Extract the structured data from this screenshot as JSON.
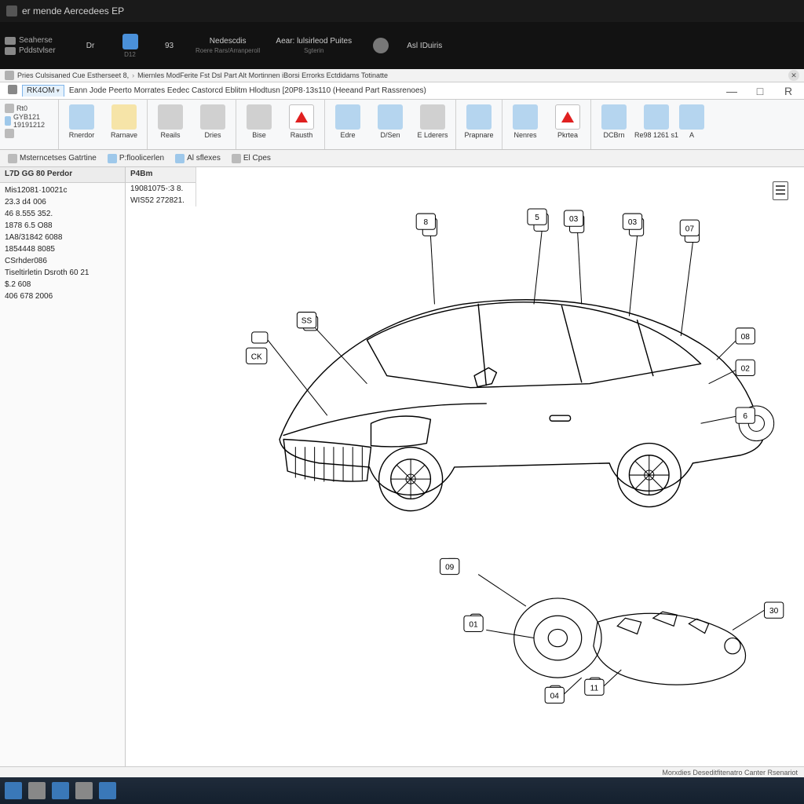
{
  "titlebar": {
    "text": "er mende Aercedees EP"
  },
  "darkband": {
    "sidecol": [
      {
        "icon": "doc-icon",
        "label": "Seaherse"
      },
      {
        "icon": "db-icon",
        "label": "Pddstvlser"
      }
    ],
    "buttons": [
      {
        "name": "dark-btn-1",
        "label1": "Dr",
        "label2": "",
        "variant": "gray"
      },
      {
        "name": "dark-btn-2",
        "label1": "",
        "label2": "D12",
        "variant": "blue"
      },
      {
        "name": "dark-btn-3",
        "label1": "93",
        "label2": "",
        "variant": "blue"
      },
      {
        "name": "dark-btn-4",
        "label1": "Nedescdis",
        "label2": "Roere Rars/Arranperoll",
        "variant": "gray"
      },
      {
        "name": "dark-btn-5",
        "label1": "Aear: lulsirleod Puites",
        "label2": "Sgterin",
        "variant": "gray"
      },
      {
        "name": "dark-btn-6",
        "label1": "",
        "label2": "",
        "variant": "gear"
      },
      {
        "name": "dark-btn-7",
        "label1": "Asl IDuiris",
        "label2": "",
        "variant": "gray"
      }
    ]
  },
  "crumbs": [
    "Pries Culsisaned Cue Estherseet 8,",
    "Miernles ModFerite Fst Dsl Part Alt Mortinnen iBorsi Errorks Ectdidams Totinatte"
  ],
  "menubar": {
    "items": [
      {
        "name": "menu-icon-1",
        "label": "",
        "icon": true
      },
      {
        "name": "menu-item-0",
        "label": "RK4OM",
        "dropdown": true,
        "selected": true
      },
      {
        "name": "menu-item-1",
        "label": "Eann Jode Peerto Morrates Eedec Castorcd Eblitm Hlodtusn [20P8·13s110  (Heeand   Part Rassrenoes)"
      }
    ]
  },
  "ribbon": {
    "groups": [
      {
        "name": "grp-session",
        "mini": [
          {
            "name": "mini-r1",
            "label": "Rt0"
          },
          {
            "name": "mini-r2",
            "label": "GYB121 19191212"
          },
          {
            "name": "mini-r3",
            "label": ""
          }
        ]
      },
      {
        "name": "grp-nav",
        "buttons": [
          {
            "name": "rib-btn-reload",
            "label": "Rnerdor",
            "variant": "blue"
          },
          {
            "name": "rib-btn-renove",
            "label": "Rarnave",
            "variant": "y"
          }
        ]
      },
      {
        "name": "grp-docs",
        "buttons": [
          {
            "name": "rib-btn-reals",
            "label": "Reails",
            "variant": "g"
          },
          {
            "name": "rib-btn-drles",
            "label": "Dries",
            "variant": "g"
          }
        ]
      },
      {
        "name": "grp-data",
        "buttons": [
          {
            "name": "rib-btn-bise",
            "label": "Bise",
            "variant": "g"
          },
          {
            "name": "rib-btn-rasth",
            "label": "Rausth",
            "variant": "r"
          }
        ]
      },
      {
        "name": "grp-edit",
        "buttons": [
          {
            "name": "rib-btn-edre",
            "label": "Edre",
            "variant": "blue"
          },
          {
            "name": "rib-btn-dgen",
            "label": "D/Sen",
            "variant": "blue"
          },
          {
            "name": "rib-btn-elderers",
            "label": "E Lderers",
            "variant": "g"
          }
        ]
      },
      {
        "name": "grp-page",
        "buttons": [
          {
            "name": "rib-btn-prapre",
            "label": "Prapnare",
            "variant": "blue"
          }
        ]
      },
      {
        "name": "grp-rpt",
        "buttons": [
          {
            "name": "rib-btn-nerres",
            "label": "Nenres",
            "variant": "blue"
          },
          {
            "name": "rib-btn-pkrtea",
            "label": "Pkrtea",
            "variant": "r"
          }
        ]
      },
      {
        "name": "grp-export",
        "buttons": [
          {
            "name": "rib-btn-dcrea",
            "label": "DCBrn",
            "variant": "blue"
          },
          {
            "name": "rib-btn-repi",
            "label": "Re98 1261 s1",
            "variant": "blue"
          },
          {
            "name": "rib-btn-a1",
            "label": "A",
            "variant": "blue"
          }
        ]
      }
    ]
  },
  "secbar": {
    "tabs": [
      {
        "name": "sec-tab-0",
        "label": "Msterncetses Gatrtine",
        "icon": "g"
      },
      {
        "name": "sec-tab-1",
        "label": "P:floolicerlen",
        "icon": "blue"
      },
      {
        "name": "sec-tab-2",
        "label": "Al sflexes",
        "icon": "blue"
      },
      {
        "name": "sec-tab-3",
        "label": "El Cpes",
        "icon": "g"
      }
    ]
  },
  "sidebar": {
    "header": "L7D GG 80 Perdor",
    "rows": [
      "Mis12081·10021c",
      "23.3 d4 006",
      "46 8.555 352.",
      "1878 6.5 O88",
      "1A8/31842 6088",
      "1854448 8085",
      "CSrhder086",
      "Tiseltirletin Dsroth 60 21",
      "$.2 608",
      "406 678 2006"
    ]
  },
  "secondcol": {
    "header": "P4Bm",
    "rows": [
      "19081075-:3 8.",
      "WIS52 272821."
    ]
  },
  "statusbar": {
    "text": "Morxdies Deseditfitenatro Canter Rsenariot"
  },
  "diagram": {
    "callouts": [
      {
        "id": "c1",
        "label": "8"
      },
      {
        "id": "c2",
        "label": "5"
      },
      {
        "id": "c3",
        "label": "CK"
      },
      {
        "id": "c4",
        "label": "SS"
      },
      {
        "id": "c5",
        "label": "03"
      },
      {
        "id": "c6",
        "label": "03"
      },
      {
        "id": "c7",
        "label": "07"
      },
      {
        "id": "c8",
        "label": "08"
      },
      {
        "id": "c9",
        "label": "02"
      },
      {
        "id": "c10",
        "label": "6"
      },
      {
        "id": "c11",
        "label": "09"
      },
      {
        "id": "c12",
        "label": "01"
      },
      {
        "id": "c13",
        "label": "04"
      },
      {
        "id": "c14",
        "label": "30"
      },
      {
        "id": "c15",
        "label": "11"
      }
    ]
  }
}
